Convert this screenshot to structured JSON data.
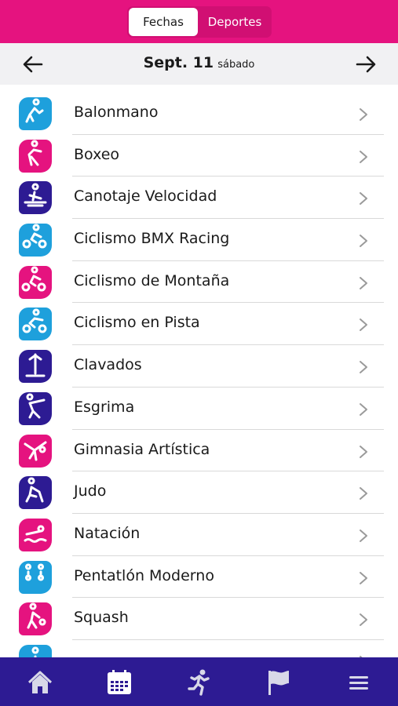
{
  "tabs": {
    "dates": "Fechas",
    "sports": "Deportes"
  },
  "date": {
    "day": "Sept. 11",
    "weekday": "sábado"
  },
  "sports": [
    {
      "label": "Balonmano",
      "color": "#1ea0dc",
      "icon": "handball-icon"
    },
    {
      "label": "Boxeo",
      "color": "#e5137f",
      "icon": "boxing-icon"
    },
    {
      "label": "Canotaje Velocidad",
      "color": "#2d1b93",
      "icon": "canoe-sprint-icon"
    },
    {
      "label": "Ciclismo BMX Racing",
      "color": "#1ea0dc",
      "icon": "bmx-icon"
    },
    {
      "label": "Ciclismo de Montaña",
      "color": "#e5137f",
      "icon": "mountain-bike-icon"
    },
    {
      "label": "Ciclismo en Pista",
      "color": "#1ea0dc",
      "icon": "track-cycling-icon"
    },
    {
      "label": "Clavados",
      "color": "#2d1b93",
      "icon": "diving-icon"
    },
    {
      "label": "Esgrima",
      "color": "#2d1b93",
      "icon": "fencing-icon"
    },
    {
      "label": "Gimnasia Artística",
      "color": "#e5137f",
      "icon": "gymnastics-icon"
    },
    {
      "label": "Judo",
      "color": "#2d1b93",
      "icon": "judo-icon"
    },
    {
      "label": "Natación",
      "color": "#e5137f",
      "icon": "swimming-icon"
    },
    {
      "label": "Pentatlón Moderno",
      "color": "#1ea0dc",
      "icon": "modern-pentathlon-icon"
    },
    {
      "label": "Squash",
      "color": "#e5137f",
      "icon": "squash-icon"
    },
    {
      "label": "",
      "color": "#1ea0dc",
      "icon": "sport-icon"
    }
  ],
  "nav": [
    {
      "name": "home-icon"
    },
    {
      "name": "calendar-icon"
    },
    {
      "name": "sports-runner-icon"
    },
    {
      "name": "flag-icon"
    },
    {
      "name": "menu-icon"
    }
  ]
}
